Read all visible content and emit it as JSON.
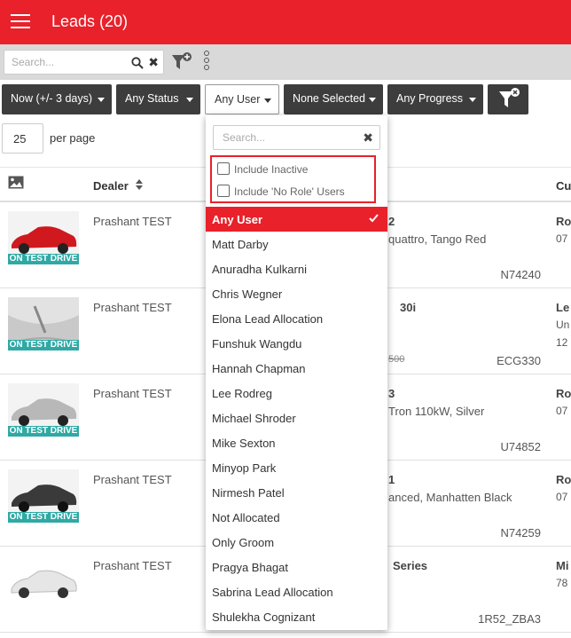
{
  "colors": {
    "brand_red": "#e8212a",
    "dark_button": "#3d3d3d",
    "badge_teal": "#2fa9a5"
  },
  "header": {
    "title": "Leads (20)",
    "menu_icon": "hamburger-icon"
  },
  "toolbar": {
    "search_placeholder": "Search...",
    "search_icon": "search-icon",
    "clear_icon": "close-icon",
    "clear_glyph": "✖",
    "add_filter_icon": "filter-add-icon",
    "more_icon": "kebab-icon"
  },
  "filters": {
    "date": "Now (+/- 3 days)",
    "status": "Any Status",
    "user": "Any User",
    "selection": "None Selected",
    "progress": "Any Progress",
    "clear_filter_icon": "filter-clear-icon"
  },
  "paging": {
    "per_page_value": "25",
    "per_page_label": "per page"
  },
  "table": {
    "image_column_icon": "image-icon",
    "dealer_header": "Dealer",
    "customer_header_partial": "Cu",
    "rows": [
      {
        "badge": "ON TEST DRIVE",
        "dealer": "Prashant TEST",
        "vehicle_line1": "2",
        "vehicle_line2": "quattro, Tango Red",
        "price_struck": "",
        "stock": "N74240",
        "customer_line1": "Ro",
        "customer_line2": "07",
        "customer_line3": ""
      },
      {
        "badge": "ON TEST DRIVE",
        "dealer": "Prashant TEST",
        "vehicle_line1": "30i",
        "vehicle_line2": "",
        "price_struck": "500",
        "stock": "ECG330",
        "customer_line1": "Le",
        "customer_line2": "Un",
        "customer_line3": "12"
      },
      {
        "badge": "ON TEST DRIVE",
        "dealer": "Prashant TEST",
        "vehicle_line1": "3",
        "vehicle_line2": "Tron 110kW, Silver",
        "price_struck": "",
        "stock": "U74852",
        "customer_line1": "Ro",
        "customer_line2": "07",
        "customer_line3": ""
      },
      {
        "badge": "ON TEST DRIVE",
        "dealer": "Prashant TEST",
        "vehicle_line1": "1",
        "vehicle_line2": "anced, Manhatten Black",
        "price_struck": "",
        "stock": "N74259",
        "customer_line1": "Ro",
        "customer_line2": "07",
        "customer_line3": ""
      },
      {
        "badge": "",
        "dealer": "Prashant TEST",
        "vehicle_line1": "Series",
        "vehicle_line2": "",
        "price_struck": "",
        "stock": "1R52_ZBA3",
        "customer_line1": "Mi",
        "customer_line2": "78",
        "customer_line3": ""
      }
    ]
  },
  "user_dropdown": {
    "search_placeholder": "Search...",
    "clear_glyph": "✖",
    "include_inactive": {
      "label": "Include Inactive",
      "checked": false
    },
    "include_no_role": {
      "label": "Include 'No Role' Users",
      "checked": false
    },
    "selected_index": 0,
    "options": [
      "Any User",
      "Matt Darby",
      "Anuradha Kulkarni",
      "Chris Wegner",
      "Elona Lead Allocation",
      "Funshuk Wangdu",
      "Hannah Chapman",
      "Lee Rodreg",
      "Michael Shroder",
      "Mike Sexton",
      "Minyop Park",
      "Nirmesh Patel",
      "Not Allocated",
      "Only Groom",
      "Pragya Bhagat",
      "Sabrina Lead Allocation",
      "Shulekha Cognizant"
    ]
  }
}
